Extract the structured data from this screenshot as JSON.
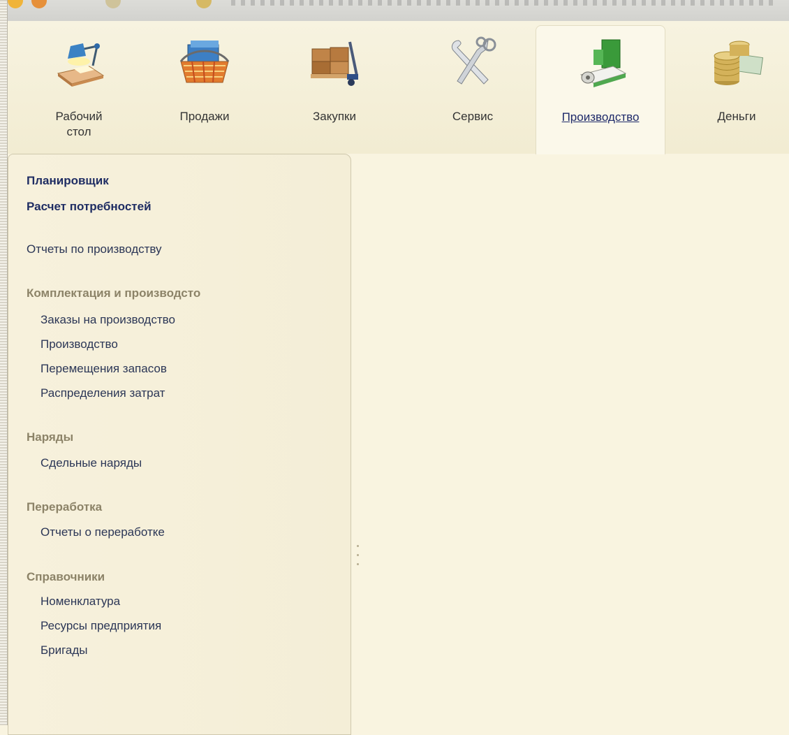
{
  "sections": [
    {
      "label": "Рабочий стол",
      "icon": "desk-lamp-icon"
    },
    {
      "label": "Продажи",
      "icon": "basket-icon"
    },
    {
      "label": "Закупки",
      "icon": "pallet-boxes-icon"
    },
    {
      "label": "Сервис",
      "icon": "tools-icon"
    },
    {
      "label": "Производство",
      "icon": "machine-icon",
      "active": true
    },
    {
      "label": "Деньги",
      "icon": "coins-icon"
    }
  ],
  "panel": {
    "commands": [
      "Планировщик",
      "Расчет потребностей"
    ],
    "reports": "Отчеты по производству",
    "groups": [
      {
        "title": "Комплектация и производсто",
        "items": [
          "Заказы на производство",
          "Производство",
          "Перемещения запасов",
          "Распределения затрат"
        ]
      },
      {
        "title": "Наряды",
        "items": [
          "Сдельные наряды"
        ]
      },
      {
        "title": "Переработка",
        "items": [
          "Отчеты о переработке"
        ]
      },
      {
        "title": "Справочники",
        "items": [
          "Номенклатура",
          "Ресурсы предприятия",
          "Бригады"
        ]
      }
    ]
  },
  "colors": {
    "background": "#f9f4e0",
    "bold_link": "#1f2d63",
    "group_title": "#8c8368"
  }
}
